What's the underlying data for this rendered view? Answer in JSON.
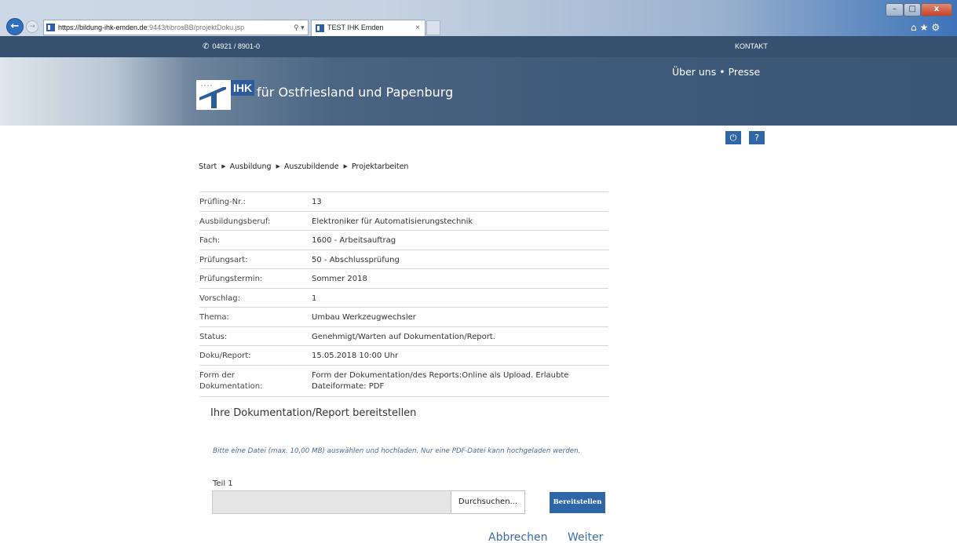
{
  "browser": {
    "url_host": "https://bildung-ihk-emden.de",
    "url_rest": ":9443/tibrosBB/projektDoku.jsp",
    "tab_title": "TEST IHK Emden",
    "tab_close": "×",
    "win_min": "–",
    "win_max": "□",
    "win_close": "x",
    "addr_tools": "⚲ ▾ 🔒 ↻",
    "right_icons": "⌂★⚙"
  },
  "header": {
    "phone": "04921 / 8901-0",
    "kontakt": "KONTAKT",
    "logo_ihk": "IHK",
    "logo_text": "für Ostfriesland und Papenburg",
    "links": "Über uns • Presse",
    "power_icon": "⏻",
    "help_icon": "?"
  },
  "breadcrumb": {
    "items": [
      "Start",
      "Ausbildung",
      "Auszubildende",
      "Projektarbeiten"
    ],
    "separator": "▶"
  },
  "details": [
    {
      "label": "Prüfling-Nr.:",
      "value": "13"
    },
    {
      "label": "Ausbildungsberuf:",
      "value": "Elektroniker für Automatisierungstechnik"
    },
    {
      "label": "Fach:",
      "value": "1600 - Arbeitsauftrag"
    },
    {
      "label": "Prüfungsart:",
      "value": "50 - Abschlussprüfung"
    },
    {
      "label": "Prüfungstermin:",
      "value": "Sommer 2018"
    },
    {
      "label": "Vorschlag:",
      "value": "1"
    },
    {
      "label": "Thema:",
      "value": "Umbau Werkzeugwechsler"
    },
    {
      "label": "Status:",
      "value": "Genehmigt/Warten auf Dokumentation/Report."
    },
    {
      "label": "Doku/Report:",
      "value": "15.05.2018 10:00 Uhr"
    },
    {
      "label": "Form der Dokumentation:",
      "value": "Form der Dokumentation/des Reports:Online als Upload. Erlaubte Dateiformate: PDF"
    }
  ],
  "upload": {
    "section_title": "Ihre Dokumentation/Report bereitstellen",
    "hint": "Bitte eine Datei (max. 10,00 MB) auswählen und hochladen. Nur eine PDF-Datei kann hochgeladen werden.",
    "part_label": "Teil 1",
    "file_value": "",
    "browse_label": "Durchsuchen...",
    "submit_label": "Bereitstellen"
  },
  "footer_actions": {
    "cancel": "Abbrechen",
    "next": "Weiter"
  },
  "colors": {
    "accent": "#2f66a8",
    "header_dark": "#36516f",
    "link": "#3a6ea8"
  }
}
